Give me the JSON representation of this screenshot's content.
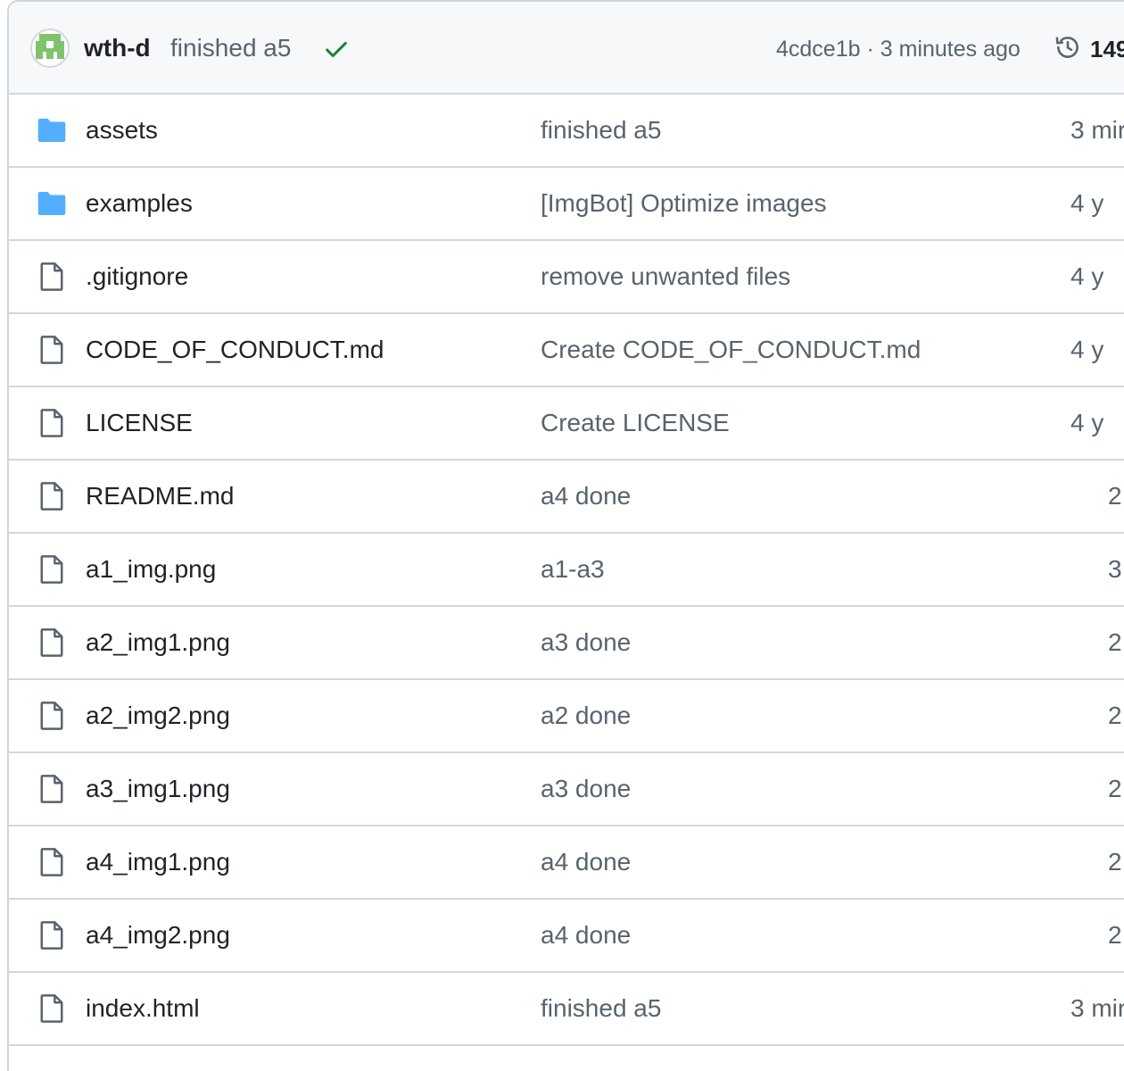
{
  "latest_commit": {
    "author": "wth-d",
    "message": "finished a5",
    "status_icon": "check-icon",
    "hash": "4cdce1b",
    "separator": "·",
    "time": "3 minutes ago",
    "history_icon": "history-icon",
    "history_count": "149"
  },
  "colors": {
    "folder": "#54aeff",
    "file_icon": "#59636e",
    "check": "#1a7f37",
    "border": "#d0d7de",
    "header_bg": "#f6f8fa"
  },
  "files": [
    {
      "type": "folder",
      "icon": "folder-icon",
      "name": "assets",
      "message": "finished a5",
      "age": "3 mir"
    },
    {
      "type": "folder",
      "icon": "folder-icon",
      "name": "examples",
      "message": "[ImgBot] Optimize images",
      "age": "4 y"
    },
    {
      "type": "file",
      "icon": "file-icon",
      "name": ".gitignore",
      "message": "remove unwanted files",
      "age": "4 y"
    },
    {
      "type": "file",
      "icon": "file-icon",
      "name": "CODE_OF_CONDUCT.md",
      "message": "Create CODE_OF_CONDUCT.md",
      "age": "4 y"
    },
    {
      "type": "file",
      "icon": "file-icon",
      "name": "LICENSE",
      "message": "Create LICENSE",
      "age": "4 y"
    },
    {
      "type": "file",
      "icon": "file-icon",
      "name": "README.md",
      "message": "a4 done",
      "age": "2"
    },
    {
      "type": "file",
      "icon": "file-icon",
      "name": "a1_img.png",
      "message": "a1-a3",
      "age": "3"
    },
    {
      "type": "file",
      "icon": "file-icon",
      "name": "a2_img1.png",
      "message": "a3 done",
      "age": "2"
    },
    {
      "type": "file",
      "icon": "file-icon",
      "name": "a2_img2.png",
      "message": "a2 done",
      "age": "2"
    },
    {
      "type": "file",
      "icon": "file-icon",
      "name": "a3_img1.png",
      "message": "a3 done",
      "age": "2"
    },
    {
      "type": "file",
      "icon": "file-icon",
      "name": "a4_img1.png",
      "message": "a4 done",
      "age": "2"
    },
    {
      "type": "file",
      "icon": "file-icon",
      "name": "a4_img2.png",
      "message": "a4 done",
      "age": "2"
    },
    {
      "type": "file",
      "icon": "file-icon",
      "name": "index.html",
      "message": "finished a5",
      "age": "3 mir"
    }
  ]
}
